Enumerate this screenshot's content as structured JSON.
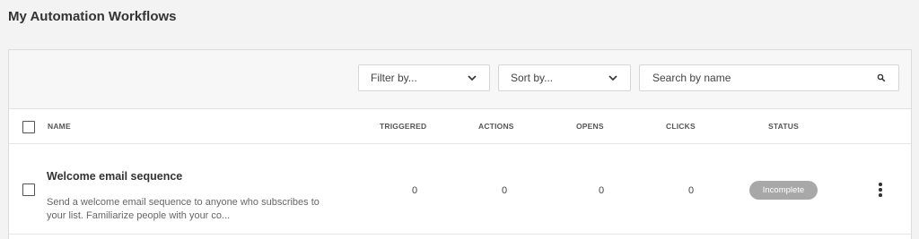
{
  "page": {
    "title": "My Automation Workflows"
  },
  "toolbar": {
    "filter_label": "Filter by...",
    "sort_label": "Sort by...",
    "search_placeholder": "Search by name"
  },
  "table": {
    "columns": {
      "name": "NAME",
      "triggered": "TRIGGERED",
      "actions": "ACTIONS",
      "opens": "OPENS",
      "clicks": "CLICKS",
      "status": "STATUS"
    },
    "rows": [
      {
        "name": "Welcome email sequence",
        "description_line1": "Send a welcome email sequence to anyone who subscribes to",
        "description_line2": "your list. Familiarize people with your co...",
        "triggered": "0",
        "actions": "0",
        "opens": "0",
        "clicks": "0",
        "status": "Incomplete"
      }
    ]
  },
  "icons": {
    "filter_chevron": "chevron-down-icon",
    "sort_chevron": "chevron-down-icon",
    "search": "search-icon",
    "row_menu": "more-vertical-icon"
  },
  "colors": {
    "status_badge_bg": "#a8a8a8",
    "page_bg": "#f3f3f3"
  }
}
